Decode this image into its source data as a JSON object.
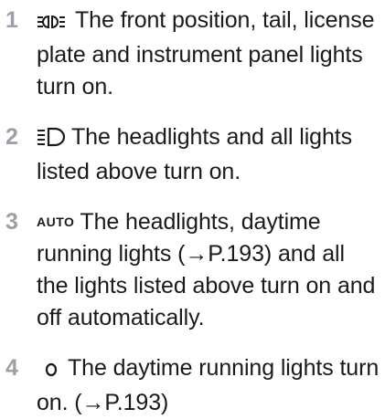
{
  "steps": [
    {
      "number": "1",
      "icon": "parking-lights-icon",
      "text": "The front position, tail, license plate and instrument panel lights turn on."
    },
    {
      "number": "2",
      "icon": "headlight-icon",
      "text": "The headlights and all lights listed above turn on."
    },
    {
      "number": "3",
      "icon_label": "AUTO",
      "text": "The headlights, daytime running lights (→P.193) and all the lights listed above turn on and off automatically."
    },
    {
      "number": "4",
      "icon": "off-circle-icon",
      "text": "The daytime running lights turn on. (→P.193)"
    }
  ],
  "colors": {
    "step_number": "#9aa0a6",
    "text": "#1a1a1a"
  }
}
